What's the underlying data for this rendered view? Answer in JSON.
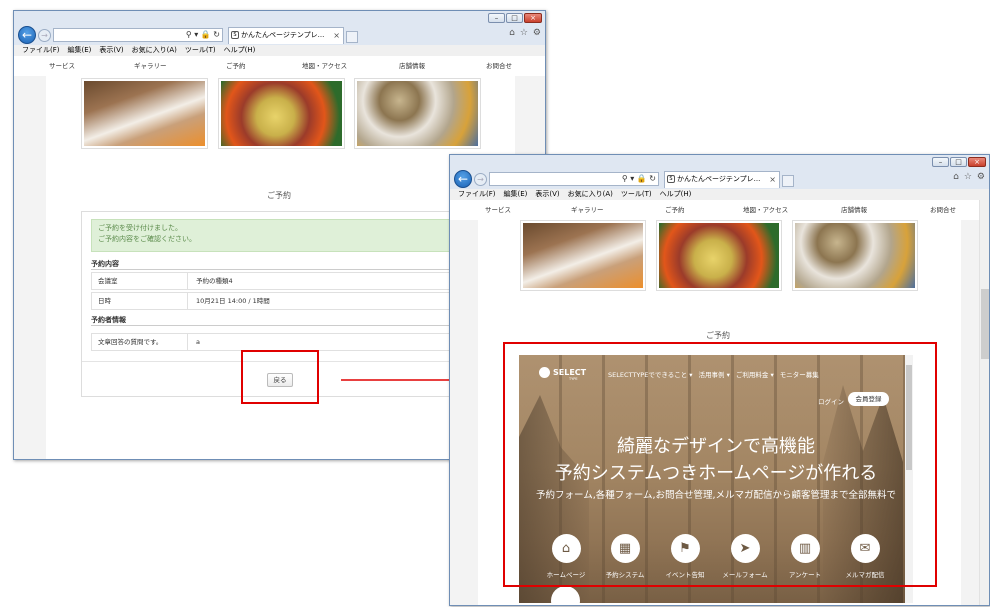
{
  "browser": {
    "tab_title": "かんたんページテンプレ...",
    "tab_close": "×",
    "back_icon": "←",
    "fwd_icon": "→",
    "addr_tools": "⚲ ▾ 🔒 ↻",
    "home_icon": "⌂",
    "star_icon": "☆",
    "gear_icon": "⚙",
    "tab_favicon": "S",
    "window_min": "–",
    "window_max": "□",
    "window_close": "×",
    "menu": [
      "ファイル(F)",
      "編集(E)",
      "表示(V)",
      "お気に入り(A)",
      "ツール(T)",
      "ヘルプ(H)"
    ]
  },
  "site_nav": [
    "サービス",
    "ギャラリー",
    "ご予約",
    "地図・アクセス",
    "店舗情報",
    "お問合せ"
  ],
  "reservation": {
    "section_title": "ご予約",
    "alert_line1": "ご予約を受け付けました。",
    "alert_line2": "ご予約内容をご確認ください。",
    "details_heading": "予約内容",
    "rows": [
      {
        "label": "会議室",
        "value": "予約の種類4"
      },
      {
        "label": "日時",
        "value": "10月21日 14:00 / 1時間"
      }
    ],
    "booker_heading": "予約者情報",
    "booker_rows": [
      {
        "label": "文章回答の質問です。",
        "value": "a"
      }
    ],
    "back_button": "戻る"
  },
  "section_title_2": "ご予約",
  "selecttype": {
    "logo": "SELECT",
    "logo_sub": "TYPE",
    "nav": [
      "SELECTTYPEでできること ▾",
      "活用事例 ▾",
      "ご利用料金 ▾",
      "モニター募集"
    ],
    "login": "ログイン",
    "signup": "会員登録",
    "headline_1": "綺麗なデザインで高機能",
    "headline_2": "予約システムつきホームページが作れる",
    "description": "予約フォーム,各種フォーム,お問合せ管理,メルマガ配信から顧客管理まで全部無料で",
    "features": [
      {
        "icon": "⌂",
        "label": "ホームページ"
      },
      {
        "icon": "▦",
        "label": "予約システム"
      },
      {
        "icon": "⚑",
        "label": "イベント告知"
      },
      {
        "icon": "➤",
        "label": "メールフォーム"
      },
      {
        "icon": "▥",
        "label": "アンケート"
      },
      {
        "icon": "✉",
        "label": "メルマガ配信"
      }
    ]
  },
  "scroll_top_icon": "↑",
  "colors": {
    "annotation_red": "#e00000",
    "alert_bg": "#dff0d8",
    "ie_blue": "#1b63b6"
  }
}
